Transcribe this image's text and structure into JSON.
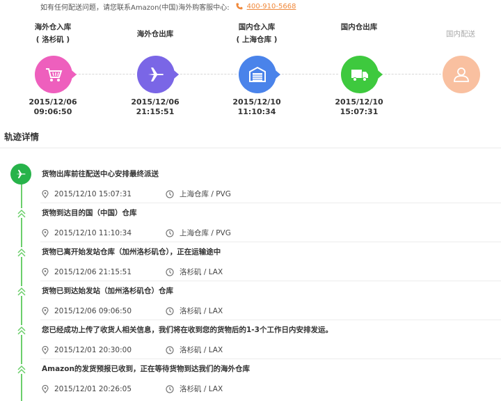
{
  "notice": {
    "text": "如有任何配送问题，请您联系Amazon(中国)海外购客服中心:",
    "phone": "400-910-5668"
  },
  "colors": {
    "pink": "#ee5fbd",
    "purple": "#7a66e6",
    "blue": "#4a83ea",
    "green": "#3ec93e",
    "peach": "#f9c0a0",
    "timeline_green": "#27b34a"
  },
  "steps": [
    {
      "label": "海外仓入库",
      "sub": "( 洛杉矶 )",
      "date": "2015/12/06",
      "time": "09:06:50",
      "icon": "cart-icon",
      "status": "done"
    },
    {
      "label": "海外仓出库",
      "sub": "",
      "date": "2015/12/06",
      "time": "21:15:51",
      "icon": "plane-icon",
      "status": "done"
    },
    {
      "label": "国内仓入库",
      "sub": "( 上海仓库 )",
      "date": "2015/12/10",
      "time": "11:10:34",
      "icon": "warehouse-icon",
      "status": "done"
    },
    {
      "label": "国内仓出库",
      "sub": "",
      "date": "2015/12/10",
      "time": "15:07:31",
      "icon": "truck-icon",
      "status": "done"
    },
    {
      "label": "国内配送",
      "sub": "",
      "date": "",
      "time": "",
      "icon": "person-icon",
      "status": "pending"
    }
  ],
  "section_title": "轨迹详情",
  "events": [
    {
      "title": "货物出库前往配送中心安排最终派送",
      "time": "2015/12/10 15:07:31",
      "location": "上海仓库 / PVG"
    },
    {
      "title": "货物到达目的国（中国）仓库",
      "time": "2015/12/10 11:10:34",
      "location": "上海仓库 / PVG"
    },
    {
      "title": "货物已离开始发站仓库（加州洛杉矶仓），正在运输途中",
      "time": "2015/12/06 21:15:51",
      "location": "洛杉矶 / LAX"
    },
    {
      "title": "货物已到达始发站（加州洛杉矶仓）仓库",
      "time": "2015/12/06 09:06:50",
      "location": "洛杉矶 / LAX"
    },
    {
      "title": "您已经成功上传了收货人相关信息，我们将在收到您的货物后的1-3个工作日内安排发运。",
      "time": "2015/12/01 20:30:00",
      "location": "洛杉矶 / LAX"
    },
    {
      "title": "Amazon的发货预报已收到，正在等待货物到达我们的海外仓库",
      "time": "2015/12/01 20:26:05",
      "location": "洛杉矶 / LAX"
    }
  ]
}
